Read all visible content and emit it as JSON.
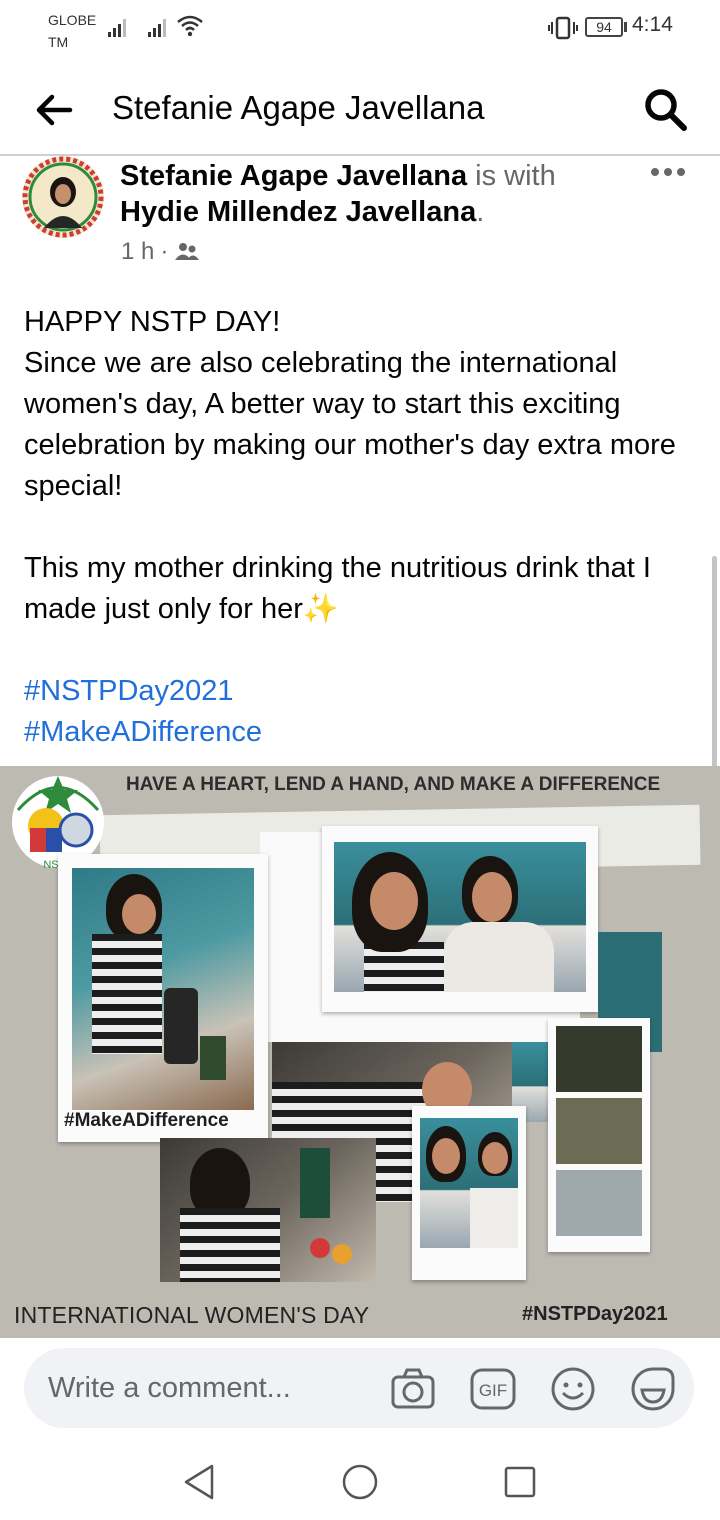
{
  "status_bar": {
    "carrier_line1": "GLOBE",
    "carrier_line2": "TM",
    "battery_level": "94",
    "time": "4:14"
  },
  "header": {
    "back_icon": "arrow-left-icon",
    "title": "Stefanie Agape Javellana",
    "search_icon": "search-icon"
  },
  "post": {
    "author": "Stefanie Agape Javellana",
    "with_text": " is with",
    "tagged": "Hydie Millendez Javellana",
    "tagged_suffix": ".",
    "time": "1 h",
    "separator": "·",
    "privacy_icon": "friends-icon",
    "more_icon": "more-dots-icon",
    "lines": [
      "HAPPY NSTP DAY!",
      "Since we are also celebrating the international women's day, A better way to start this exciting celebration by making our mother's day extra more special!",
      "This my mother drinking the nutritious drink that I made just only for her"
    ],
    "sparkle_emoji": "✨",
    "hashtags": [
      "#NSTPDay2021",
      "#MakeADifference"
    ]
  },
  "image": {
    "banner": "HAVE A HEART, LEND A HAND, AND MAKE A DIFFERENCE",
    "logo_text": "NSTP",
    "caption": "#MakeADifference",
    "bottom_left": "INTERNATIONAL WOMEN'S DAY",
    "bottom_right": "#NSTPDay2021",
    "swatch_colors": [
      "#353a2c",
      "#6c6c55",
      "#9fa8ac"
    ]
  },
  "comment_bar": {
    "placeholder": "Write a comment...",
    "icons": [
      "camera-icon",
      "gif-icon",
      "emoji-icon",
      "sticker-icon"
    ]
  },
  "navbar": {
    "icons": [
      "nav-back-icon",
      "nav-home-icon",
      "nav-recents-icon"
    ]
  },
  "colors": {
    "link": "#216fdb",
    "secondary_text": "#65676b",
    "comment_bg": "#f0f2f5"
  }
}
